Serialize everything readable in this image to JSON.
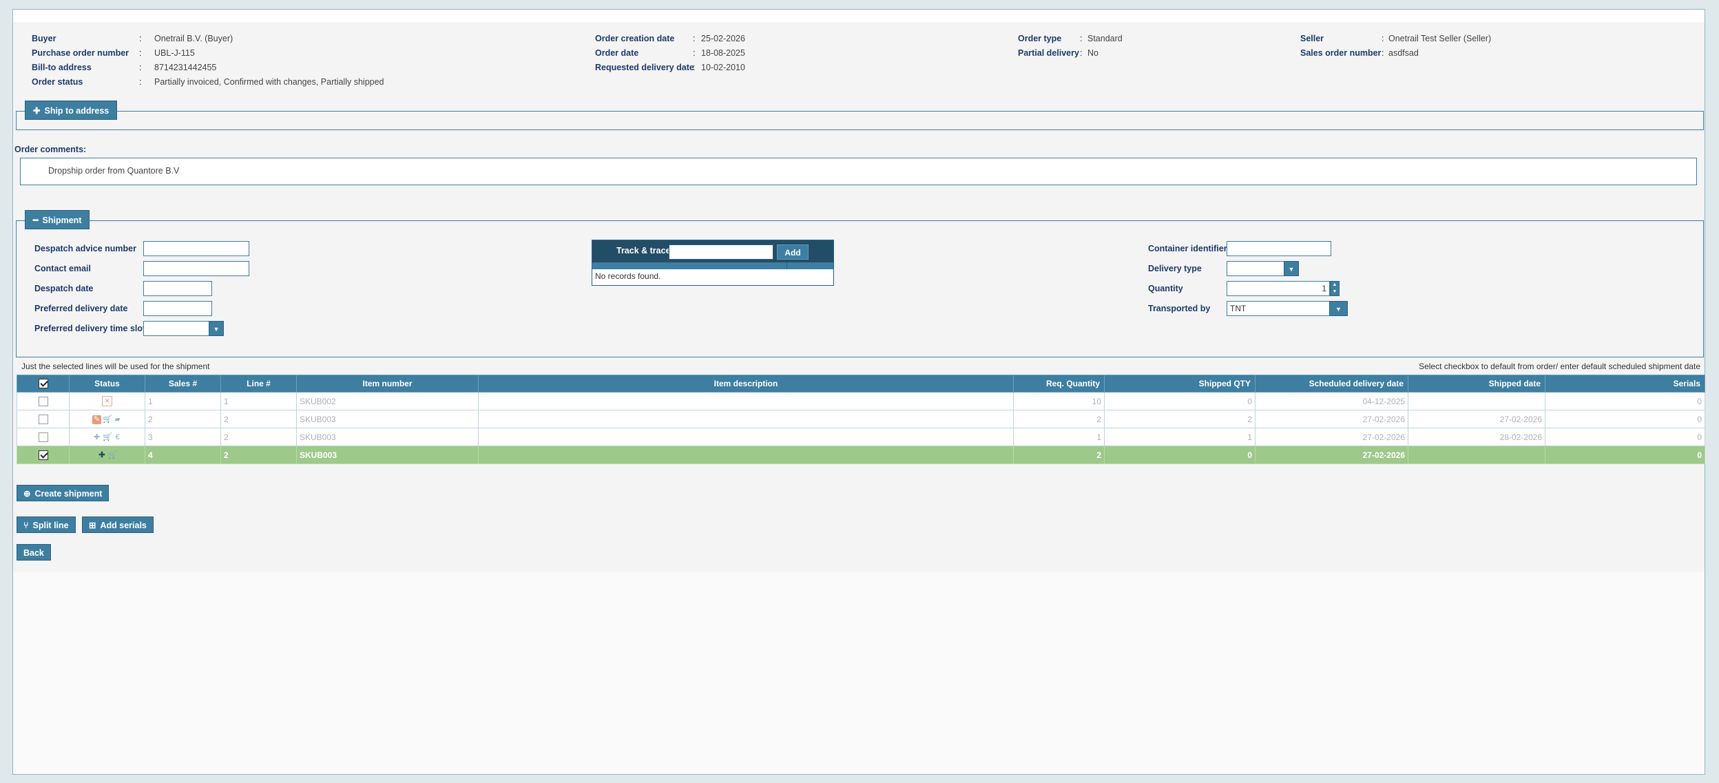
{
  "header": {
    "buyer": {
      "label": "Buyer",
      "value": "Onetrail B.V. (Buyer)"
    },
    "po_number": {
      "label": "Purchase order number",
      "value": "UBL-J-115"
    },
    "bill_to": {
      "label": "Bill-to address",
      "value": "8714231442455"
    },
    "order_status": {
      "label": "Order status",
      "value": "Partially invoiced, Confirmed with changes, Partially shipped"
    },
    "creation_date": {
      "label": "Order creation date",
      "value": "25-02-2026"
    },
    "order_date": {
      "label": "Order date",
      "value": "18-08-2025"
    },
    "requested_delivery": {
      "label": "Requested delivery date",
      "value": "10-02-2010"
    },
    "order_type": {
      "label": "Order type",
      "value": "Standard"
    },
    "partial_delivery": {
      "label": "Partial delivery",
      "value": "No"
    },
    "seller": {
      "label": "Seller",
      "value": "Onetrail Test Seller (Seller)"
    },
    "sales_order_number": {
      "label": "Sales order number",
      "value": "asdfsad"
    },
    "colon": ":"
  },
  "ship_to": {
    "label": "Ship to address",
    "icon": "plus-icon"
  },
  "comments": {
    "label": "Order comments:",
    "text": "Dropship order from Quantore B.V"
  },
  "shipment": {
    "label": "Shipment",
    "icon": "minus-icon",
    "despatch_advice_number": {
      "label": "Despatch advice number",
      "value": ""
    },
    "contact_email": {
      "label": "Contact email",
      "value": ""
    },
    "despatch_date": {
      "label": "Despatch date",
      "value": ""
    },
    "preferred_delivery_date": {
      "label": "Preferred delivery date",
      "value": ""
    },
    "preferred_time_slot": {
      "label": "Preferred delivery time slot",
      "value": ""
    },
    "track_trace": {
      "label": "Track & trace",
      "add_label": "Add",
      "empty_text": "No records found."
    },
    "container_identifier": {
      "label": "Container identifier",
      "value": ""
    },
    "delivery_type": {
      "label": "Delivery type",
      "value": ""
    },
    "quantity": {
      "label": "Quantity",
      "value": "1"
    },
    "transported_by": {
      "label": "Transported by",
      "value": "TNT"
    }
  },
  "notes": {
    "left": "Just the selected lines will be used for the shipment",
    "right": "Select checkbox to default from order/ enter default scheduled shipment date"
  },
  "table": {
    "headers": {
      "status": "Status",
      "sales": "Sales #",
      "line": "Line #",
      "item_number": "Item number",
      "item_description": "Item description",
      "req_qty": "Req. Quantity",
      "shipped_qty": "Shipped QTY",
      "scheduled_date": "Scheduled delivery date",
      "shipped_date": "Shipped date",
      "serials": "Serials"
    },
    "rows": [
      {
        "checked": false,
        "selected": false,
        "status_icons": [
          "cancel-icon"
        ],
        "sales": "1",
        "line": "1",
        "item_number": "SKUB002",
        "item_description": "",
        "req_qty": "10",
        "shipped_qty": "0",
        "scheduled_date": "04-12-2025",
        "shipped_date": "",
        "serials": "0"
      },
      {
        "checked": false,
        "selected": false,
        "status_icons": [
          "edit-icon",
          "cart-icon",
          "truck-icon"
        ],
        "sales": "2",
        "line": "2",
        "item_number": "SKUB003",
        "item_description": "",
        "req_qty": "2",
        "shipped_qty": "2",
        "scheduled_date": "27-02-2026",
        "shipped_date": "27-02-2026",
        "serials": "0"
      },
      {
        "checked": false,
        "selected": false,
        "status_icons": [
          "plus-icon",
          "cart-icon",
          "euro-icon"
        ],
        "sales": "3",
        "line": "2",
        "item_number": "SKUB003",
        "item_description": "",
        "req_qty": "1",
        "shipped_qty": "1",
        "scheduled_date": "27-02-2026",
        "shipped_date": "28-02-2026",
        "serials": "0"
      },
      {
        "checked": true,
        "selected": true,
        "status_icons": [
          "plus-icon",
          "cart-icon"
        ],
        "sales": "4",
        "line": "2",
        "item_number": "SKUB003",
        "item_description": "",
        "req_qty": "2",
        "shipped_qty": "0",
        "scheduled_date": "27-02-2026",
        "shipped_date": "",
        "serials": "0"
      }
    ]
  },
  "buttons": {
    "create_shipment": "Create shipment",
    "split_line": "Split line",
    "add_serials": "Add serials",
    "back": "Back"
  },
  "colors": {
    "accent": "#3e7ea0",
    "dark": "#234d66",
    "selected_row": "#9dc98a",
    "label": "#1e3a6b"
  }
}
